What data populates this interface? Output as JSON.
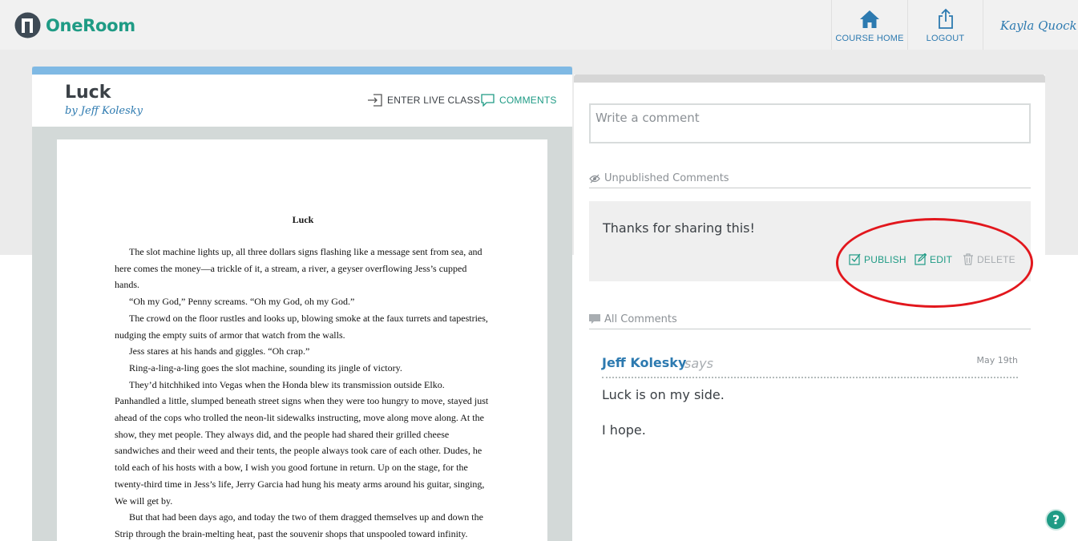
{
  "app": {
    "name": "OneRoom",
    "brand_color": "#1f9b85",
    "link_color": "#2d7ab0",
    "annotation_color": "#e2171d"
  },
  "header": {
    "course_home_label": "COURSE HOME",
    "course_home_icon": "home-icon",
    "logout_label": "LOGOUT",
    "logout_icon": "share-upload-icon",
    "user_name": "Kayla Quock"
  },
  "document": {
    "title": "Luck",
    "author": "by Jeff Kolesky",
    "enter_live_class_label": "ENTER LIVE CLASS",
    "comments_label": "COMMENTS",
    "page": {
      "heading": "Luck",
      "paragraphs": [
        "The slot machine lights up, all three dollars signs flashing like a message sent from sea, and here comes the money—a trickle of it, a stream, a river, a geyser overflowing Jess’s cupped hands.",
        "“Oh my God,” Penny screams. “Oh my God, oh my God.”",
        "The crowd on the floor rustles and looks up, blowing smoke at the faux turrets and tapestries, nudging the empty suits of armor that watch from the walls.",
        "Jess stares at his hands and giggles. “Oh crap.”",
        "Ring-a-ling-a-ling goes the slot machine, sounding its jingle of victory.",
        "They’d hitchhiked into Vegas when the Honda blew its transmission outside Elko. Panhandled a little, slumped beneath street signs when they were too hungry to move, stayed just ahead of the cops who trolled the neon-lit sidewalks instructing, move along move along. At the show, they met people. They always did, and the people had shared their grilled cheese sandwiches and their weed and their tents, the people always took care of each other. Dudes, he told each of his hosts with a bow, I wish you good fortune in return. Up on the stage, for the twenty-third time in Jess’s life, Jerry Garcia had hung his meaty arms around his guitar, singing, We will get by.",
        "But that had been days ago, and today the two of them dragged themselves up and down the Strip through the brain-melting heat, past the souvenir shops that unspooled toward infinity."
      ]
    }
  },
  "comments_panel": {
    "input_placeholder": "Write a comment",
    "unpublished_heading": "Unpublished Comments",
    "unpublished_icon": "eye-slash-icon",
    "unpublished": [
      {
        "text": "Thanks for sharing this!",
        "publish_label": "PUBLISH",
        "edit_label": "EDIT",
        "delete_label": "DELETE"
      }
    ],
    "all_heading": "All Comments",
    "all_icon": "speech-bubble-icon",
    "comments": [
      {
        "author": "Jeff Kolesky",
        "says": "says",
        "date": "May 19th",
        "lines": [
          "Luck is on my side.",
          "I hope."
        ]
      }
    ]
  },
  "help": {
    "label": "?"
  }
}
